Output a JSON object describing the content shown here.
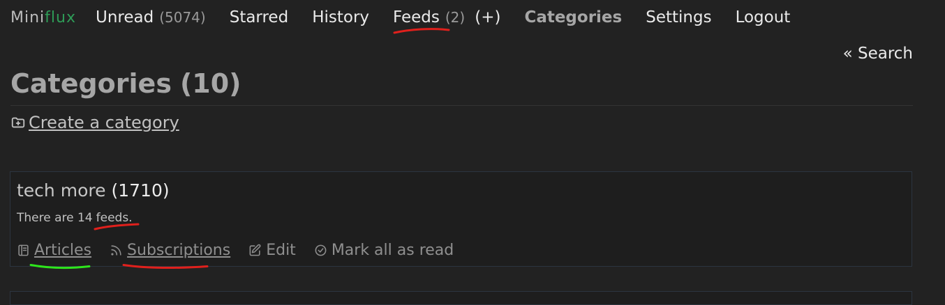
{
  "logo": {
    "part1": "Mini",
    "part2": "flux"
  },
  "nav": {
    "unread_label": "Unread",
    "unread_count": "(5074)",
    "starred_label": "Starred",
    "history_label": "History",
    "feeds_label": "Feeds",
    "feeds_count": "(2)",
    "feeds_add": "(+)",
    "categories_label": "Categories",
    "settings_label": "Settings",
    "logout_label": "Logout"
  },
  "search_link": "« Search",
  "page": {
    "title": "Categories",
    "title_count": "(10)",
    "create_label": "Create a category"
  },
  "category": {
    "name": "tech more",
    "count": "(1710)",
    "desc_prefix": "There are 14",
    "desc_feeds": "feeds.",
    "actions": {
      "articles": "Articles",
      "subscriptions": "Subscriptions",
      "edit": "Edit",
      "mark_read": "Mark all as read"
    }
  },
  "colors": {
    "background": "#222222",
    "brand_green": "#2e9c57",
    "annotation_red": "#e0201c",
    "annotation_green": "#2ee61c"
  },
  "icons": [
    "folder-plus-icon",
    "book-icon",
    "rss-icon",
    "edit-icon",
    "check-circle-icon"
  ]
}
